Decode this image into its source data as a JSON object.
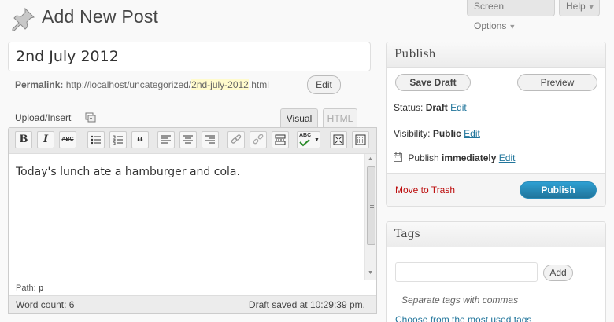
{
  "header": {
    "title": "Add New Post",
    "screen_options": "Screen Options",
    "help": "Help"
  },
  "post": {
    "title": "2nd July 2012",
    "permalink_label": "Permalink:",
    "permalink_base": "http://localhost/uncategorized/",
    "permalink_slug": "2nd-july-2012",
    "permalink_suffix": ".html",
    "edit_label": "Edit"
  },
  "editor": {
    "upload_insert": "Upload/Insert",
    "tabs": {
      "visual": "Visual",
      "html": "HTML"
    },
    "active_tab": "Visual",
    "toolbar_icons": [
      "bold-icon",
      "italic-icon",
      "strikethrough-icon",
      "unordered-list-icon",
      "ordered-list-icon",
      "blockquote-icon",
      "align-left-icon",
      "align-center-icon",
      "align-right-icon",
      "link-icon",
      "unlink-icon",
      "more-tag-icon",
      "spellcheck-icon",
      "fullscreen-icon",
      "kitchen-sink-icon"
    ],
    "toolbar_text": {
      "bold": "B",
      "italic": "I",
      "strike": "ABC",
      "quote": "“",
      "spell": "ABC"
    },
    "content": "Today's lunch ate a hamburger and cola.",
    "path_label": "Path:",
    "path_value": "p",
    "word_count": "Word count: 6",
    "draft_saved": "Draft saved at 10:29:39 pm."
  },
  "publish": {
    "title": "Publish",
    "save_draft": "Save Draft",
    "preview": "Preview",
    "status_label": "Status:",
    "status_value": "Draft",
    "visibility_label": "Visibility:",
    "visibility_value": "Public",
    "schedule_label": "Publish",
    "schedule_value": "immediately",
    "edit_label": "Edit",
    "trash": "Move to Trash",
    "publish_button": "Publish"
  },
  "tags": {
    "title": "Tags",
    "input_value": "",
    "add": "Add",
    "hint": "Separate tags with commas",
    "choose_link": "Choose from the most used tags"
  },
  "colors": {
    "link": "#21759b",
    "trash": "#bc0b0b",
    "publish_button": "#21759b",
    "slug_highlight": "#fffbcc"
  }
}
